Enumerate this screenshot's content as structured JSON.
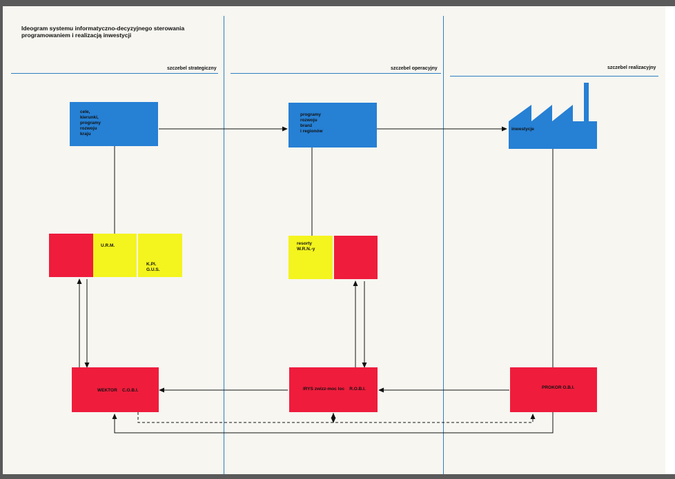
{
  "title": {
    "line1": "Ideogram systemu informatyczno-decyzyjnego sterowania",
    "line2": "programowaniem i realizacją inwestycji"
  },
  "levels": {
    "strategic": "szczebel strategiczny",
    "operational": "szczebel operacyjny",
    "implementation": "szczebel realizacyjny"
  },
  "boxes": {
    "goals": "cele,\nkierunki,\nprogramy\nrozwoju\nkraju",
    "programs": "programy\nrozwoju\nbranż\ni regionów",
    "investments": "inwestycje",
    "urm": "U.R.M.",
    "kpl_gus": "K.Pl.\nG.U.S.",
    "resorty": "resorty\nW.R.N.-y",
    "wektor": "WEKTOR    C.O.B.I.",
    "irys": "IRYS zwizz-moc loc    R.O.B.I.",
    "prokor": "PROKOR O.B.I."
  },
  "colors": {
    "blue": "#2680d4",
    "red": "#ef1c3c",
    "yellow": "#f4f41e",
    "rule": "#2c7fc0"
  },
  "icons": {
    "factory": "factory-icon"
  }
}
